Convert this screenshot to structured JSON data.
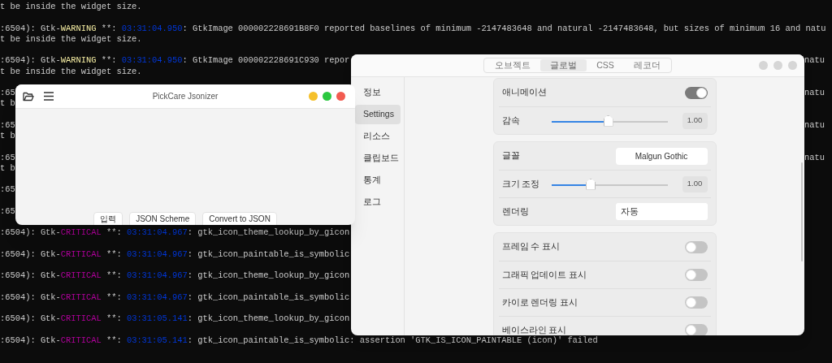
{
  "terminal": {
    "entries": [
      {
        "lines": [
          {
            "segments": [
              {
                "kind": "plain",
                "text": "t be inside the widget size."
              }
            ]
          }
        ]
      },
      {
        "lines": [
          {
            "segments": [
              {
                "kind": "plain",
                "text": ":6504): Gtk-"
              },
              {
                "kind": "warning",
                "text": "WARNING"
              },
              {
                "kind": "plain",
                "text": " **: "
              },
              {
                "kind": "time",
                "text": "03:31:04.950"
              },
              {
                "kind": "plain",
                "text": ": GtkImage 000002228691B8F0 reported baselines of minimum -2147483648 and natural -2147483648, but sizes of minimum 16 and natu"
              }
            ]
          },
          {
            "segments": [
              {
                "kind": "plain",
                "text": "t be inside the widget size."
              }
            ]
          }
        ]
      },
      {
        "lines": [
          {
            "segments": [
              {
                "kind": "plain",
                "text": ":6504): Gtk-"
              },
              {
                "kind": "warning",
                "text": "WARNING"
              },
              {
                "kind": "plain",
                "text": " **: "
              },
              {
                "kind": "time",
                "text": "03:31:04.950"
              },
              {
                "kind": "plain",
                "text": ": GtkImage 000002228691C930 repor"
              }
            ],
            "tail": "natu"
          },
          {
            "segments": [
              {
                "kind": "plain",
                "text": "t be inside the widget size."
              }
            ]
          }
        ]
      },
      {
        "lines": [
          {
            "segments": [
              {
                "kind": "plain",
                "text": ":65"
              }
            ],
            "tail": "natu"
          },
          {
            "segments": [
              {
                "kind": "plain",
                "text": "t b"
              }
            ]
          }
        ]
      },
      {
        "lines": [
          {
            "segments": [
              {
                "kind": "plain",
                "text": ":65"
              }
            ],
            "tail": "natu"
          },
          {
            "segments": [
              {
                "kind": "plain",
                "text": "t b"
              }
            ]
          }
        ]
      },
      {
        "lines": [
          {
            "segments": [
              {
                "kind": "plain",
                "text": ":65"
              }
            ],
            "tail": "natu"
          },
          {
            "segments": [
              {
                "kind": "plain",
                "text": "t b"
              }
            ]
          }
        ]
      },
      {
        "lines": [
          {
            "segments": [
              {
                "kind": "plain",
                "text": ":65"
              }
            ]
          }
        ]
      },
      {
        "lines": [
          {
            "segments": [
              {
                "kind": "plain",
                "text": ":65"
              }
            ]
          }
        ]
      },
      {
        "lines": [
          {
            "segments": [
              {
                "kind": "plain",
                "text": ":6504): Gtk-"
              },
              {
                "kind": "critical",
                "text": "CRITICAL"
              },
              {
                "kind": "plain",
                "text": " **: "
              },
              {
                "kind": "time",
                "text": "03:31:04.967"
              },
              {
                "kind": "plain",
                "text": ": gtk_icon_theme_lookup_by_gicon"
              }
            ]
          }
        ]
      },
      {
        "lines": [
          {
            "segments": [
              {
                "kind": "plain",
                "text": ":6504): Gtk-"
              },
              {
                "kind": "critical",
                "text": "CRITICAL"
              },
              {
                "kind": "plain",
                "text": " **: "
              },
              {
                "kind": "time",
                "text": "03:31:04.967"
              },
              {
                "kind": "plain",
                "text": ": gtk_icon_paintable_is_symbolic"
              }
            ]
          }
        ]
      },
      {
        "lines": [
          {
            "segments": [
              {
                "kind": "plain",
                "text": ":6504): Gtk-"
              },
              {
                "kind": "critical",
                "text": "CRITICAL"
              },
              {
                "kind": "plain",
                "text": " **: "
              },
              {
                "kind": "time",
                "text": "03:31:04.967"
              },
              {
                "kind": "plain",
                "text": ": gtk_icon_theme_lookup_by_gicon"
              }
            ]
          }
        ]
      },
      {
        "lines": [
          {
            "segments": [
              {
                "kind": "plain",
                "text": ":6504): Gtk-"
              },
              {
                "kind": "critical",
                "text": "CRITICAL"
              },
              {
                "kind": "plain",
                "text": " **: "
              },
              {
                "kind": "time",
                "text": "03:31:04.967"
              },
              {
                "kind": "plain",
                "text": ": gtk_icon_paintable_is_symbolic"
              }
            ]
          }
        ]
      },
      {
        "lines": [
          {
            "segments": [
              {
                "kind": "plain",
                "text": ":6504): Gtk-"
              },
              {
                "kind": "critical",
                "text": "CRITICAL"
              },
              {
                "kind": "plain",
                "text": " **: "
              },
              {
                "kind": "time",
                "text": "03:31:05.141"
              },
              {
                "kind": "plain",
                "text": ": gtk_icon_theme_lookup_by_gicon"
              }
            ]
          }
        ]
      },
      {
        "lines": [
          {
            "segments": [
              {
                "kind": "plain",
                "text": ":6504): Gtk-"
              },
              {
                "kind": "critical",
                "text": "CRITICAL"
              },
              {
                "kind": "plain",
                "text": " **: "
              },
              {
                "kind": "time",
                "text": "03:31:05.141"
              },
              {
                "kind": "plain",
                "text": ": gtk_icon_paintable_is_symbolic: assertion 'GTK_IS_ICON_PAINTABLE (icon)' failed"
              }
            ]
          }
        ]
      }
    ]
  },
  "jsonizer_window": {
    "title": "PickCare Jsonizer",
    "buttons": [
      "입력",
      "JSON Scheme",
      "Convert to JSON"
    ]
  },
  "settings_window": {
    "tabs": [
      {
        "label": "오브젝트",
        "selected": false
      },
      {
        "label": "글로벌",
        "selected": true
      },
      {
        "label": "CSS",
        "selected": false
      },
      {
        "label": "레코더",
        "selected": false
      }
    ],
    "sidebar": {
      "items": [
        {
          "label": "정보",
          "selected": false
        },
        {
          "label": "Settings",
          "selected": true
        },
        {
          "label": "리소스",
          "selected": false
        },
        {
          "label": "클립보드",
          "selected": false
        },
        {
          "label": "통계",
          "selected": false
        },
        {
          "label": "로그",
          "selected": false
        }
      ]
    },
    "groups": [
      {
        "rows": [
          {
            "kind": "toggle",
            "label": "애니메이션",
            "on": true
          },
          {
            "kind": "slider",
            "label": "감속",
            "level": 0.49,
            "value": "1.00"
          }
        ]
      },
      {
        "rows": [
          {
            "kind": "font",
            "label": "글꼴",
            "value": "Malgun Gothic"
          },
          {
            "kind": "slider",
            "label": "크기 조정",
            "level": 0.34,
            "value": "1.00"
          },
          {
            "kind": "entry",
            "label": "렌더링",
            "value": "자동"
          }
        ]
      },
      {
        "rows": [
          {
            "kind": "toggle",
            "label": "프레임 수 표시",
            "on": false
          },
          {
            "kind": "toggle",
            "label": "그래픽 업데이트 표시",
            "on": false
          },
          {
            "kind": "toggle",
            "label": "카이로 렌더링 표시",
            "on": false
          },
          {
            "kind": "toggle",
            "label": "베이스라인 표시",
            "on": false
          }
        ]
      }
    ]
  }
}
